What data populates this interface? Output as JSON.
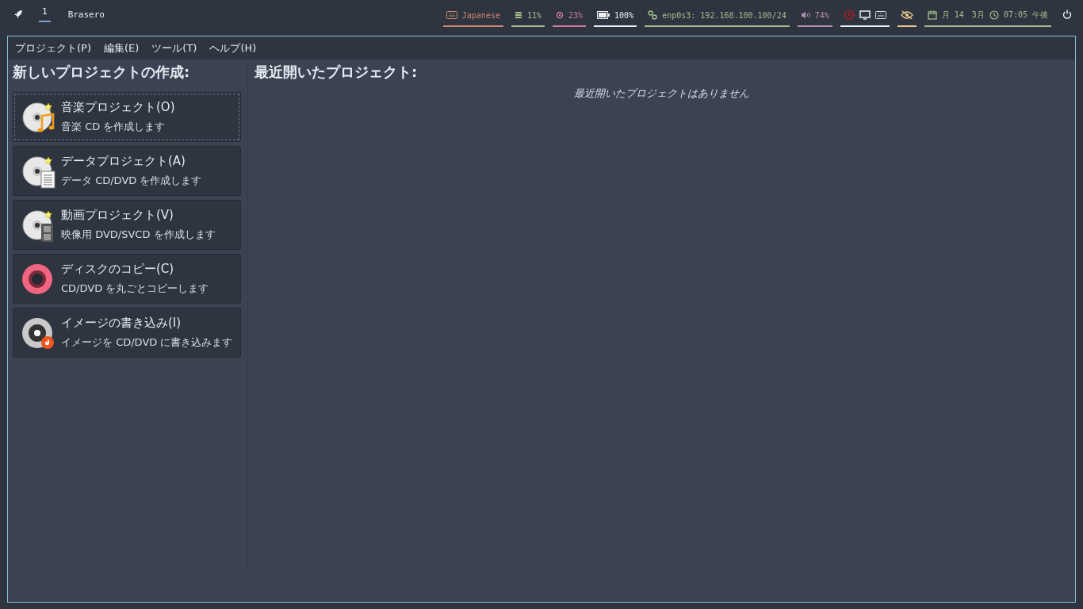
{
  "top_bar": {
    "workspace": {
      "label": "1",
      "selected": true
    },
    "window_title": "Brasero",
    "modules": [
      {
        "kind": "keyboard",
        "text": "Japanese",
        "color": "#d08770"
      },
      {
        "kind": "memory",
        "text": "11%",
        "color": "#a3be8c"
      },
      {
        "kind": "cpu",
        "text": "23%",
        "color": "#d27a9b"
      },
      {
        "kind": "battery",
        "text": "100%",
        "color": "#eceff4"
      },
      {
        "kind": "network",
        "text": "enp0s3: 192.168.100.100/24",
        "color": "#a3be8c"
      },
      {
        "kind": "volume",
        "text": "74%",
        "color": "#b48ead"
      },
      {
        "kind": "tray",
        "color": "#eceff4"
      },
      {
        "kind": "eye",
        "color": "#ebcb8b"
      },
      {
        "kind": "clock",
        "date": "月 14　3月",
        "time": "07:05 午後",
        "color": "#a3be8c"
      }
    ]
  },
  "menu": [
    "プロジェクト(P)",
    "編集(E)",
    "ツール(T)",
    "ヘルプ(H)"
  ],
  "new_project": {
    "heading": "新しいプロジェクトの作成:",
    "items": [
      {
        "kind": "music",
        "title": "音楽プロジェクト(O)",
        "description": "音楽 CD を作成します",
        "selected": true
      },
      {
        "kind": "data",
        "title": "データプロジェクト(A)",
        "description": "データ CD/DVD を作成します",
        "selected": false
      },
      {
        "kind": "video",
        "title": "動画プロジェクト(V)",
        "description": "映像用 DVD/SVCD を作成します",
        "selected": false
      },
      {
        "kind": "copy",
        "title": "ディスクのコピー(C)",
        "description": "CD/DVD を丸ごとコピーします",
        "selected": false
      },
      {
        "kind": "burn",
        "title": "イメージの書き込み(I)",
        "description": "イメージを CD/DVD に書き込みます",
        "selected": false
      }
    ]
  },
  "recent": {
    "heading": "最近開いたプロジェクト:",
    "empty_message": "最近開いたプロジェクトはありません"
  }
}
